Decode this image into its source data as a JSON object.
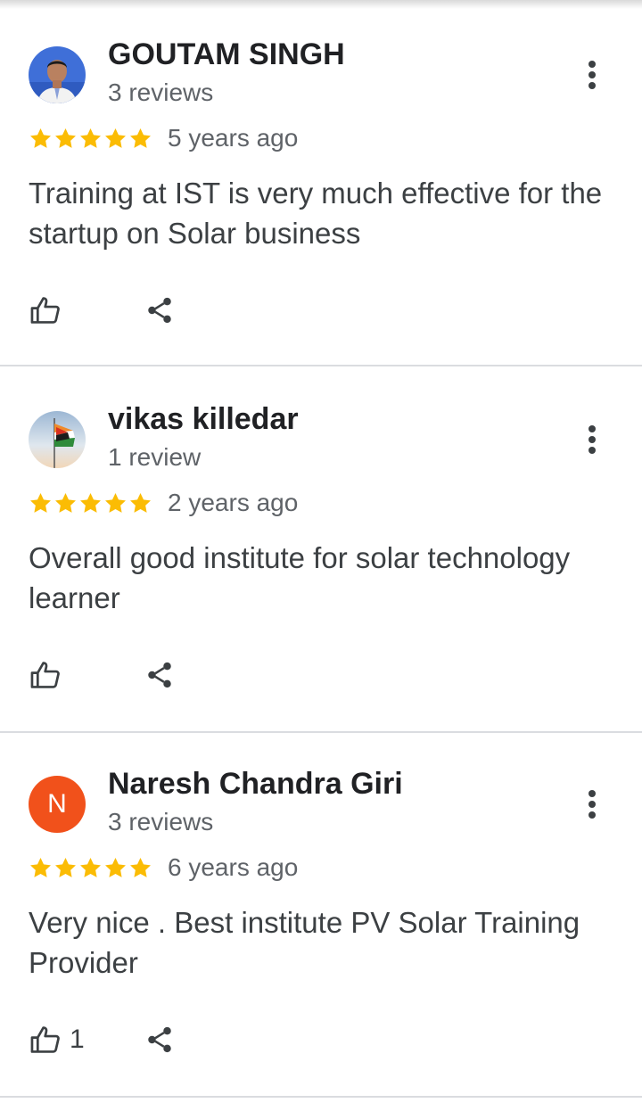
{
  "colors": {
    "star": "#fbbc04",
    "text_primary": "#202124",
    "text_secondary": "#5f6368",
    "divider": "#dadce0",
    "avatar_n_bg": "#f1511b"
  },
  "icons": {
    "star": "star-icon",
    "more": "more-vert-icon",
    "like": "thumb-up-icon",
    "share": "share-icon"
  },
  "reviews": [
    {
      "name": "GOUTAM SINGH",
      "count": "3 reviews",
      "stars": 5,
      "age": "5 years ago",
      "text": "Training at IST is very much effective for the startup on Solar business",
      "likes": ""
    },
    {
      "name": "vikas killedar",
      "count": "1 review",
      "stars": 5,
      "age": "2 years ago",
      "text": "Overall good institute for solar technology learner",
      "likes": ""
    },
    {
      "name": "Naresh Chandra Giri",
      "avatar_letter": "N",
      "count": "3 reviews",
      "stars": 5,
      "age": "6 years ago",
      "text": "Very nice . Best institute PV Solar Training Provider",
      "likes": "1"
    }
  ]
}
